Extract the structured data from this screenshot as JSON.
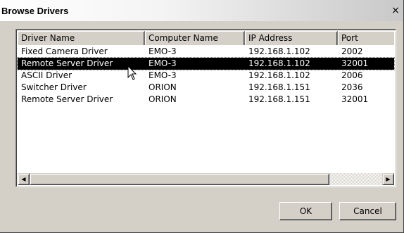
{
  "window": {
    "title": "Browse Drivers",
    "close_glyph": "×"
  },
  "table": {
    "columns": [
      "Driver Name",
      "Computer Name",
      "IP Address",
      "Port"
    ],
    "rows": [
      [
        "Fixed Camera Driver",
        "EMO-3",
        "192.168.1.102",
        "2002"
      ],
      [
        "Remote Server Driver",
        "EMO-3",
        "192.168.1.102",
        "32001"
      ],
      [
        "ASCII Driver",
        "EMO-3",
        "192.168.1.102",
        "2006"
      ],
      [
        "Switcher Driver",
        "ORION",
        "192.168.1.151",
        "2036"
      ],
      [
        "Remote Server Driver",
        "ORION",
        "192.168.1.151",
        "32001"
      ]
    ],
    "selected_row": 1
  },
  "scrollbar": {
    "left_arrow": "◀",
    "right_arrow": "▶"
  },
  "buttons": {
    "ok_label": "OK",
    "cancel_label": "Cancel"
  }
}
